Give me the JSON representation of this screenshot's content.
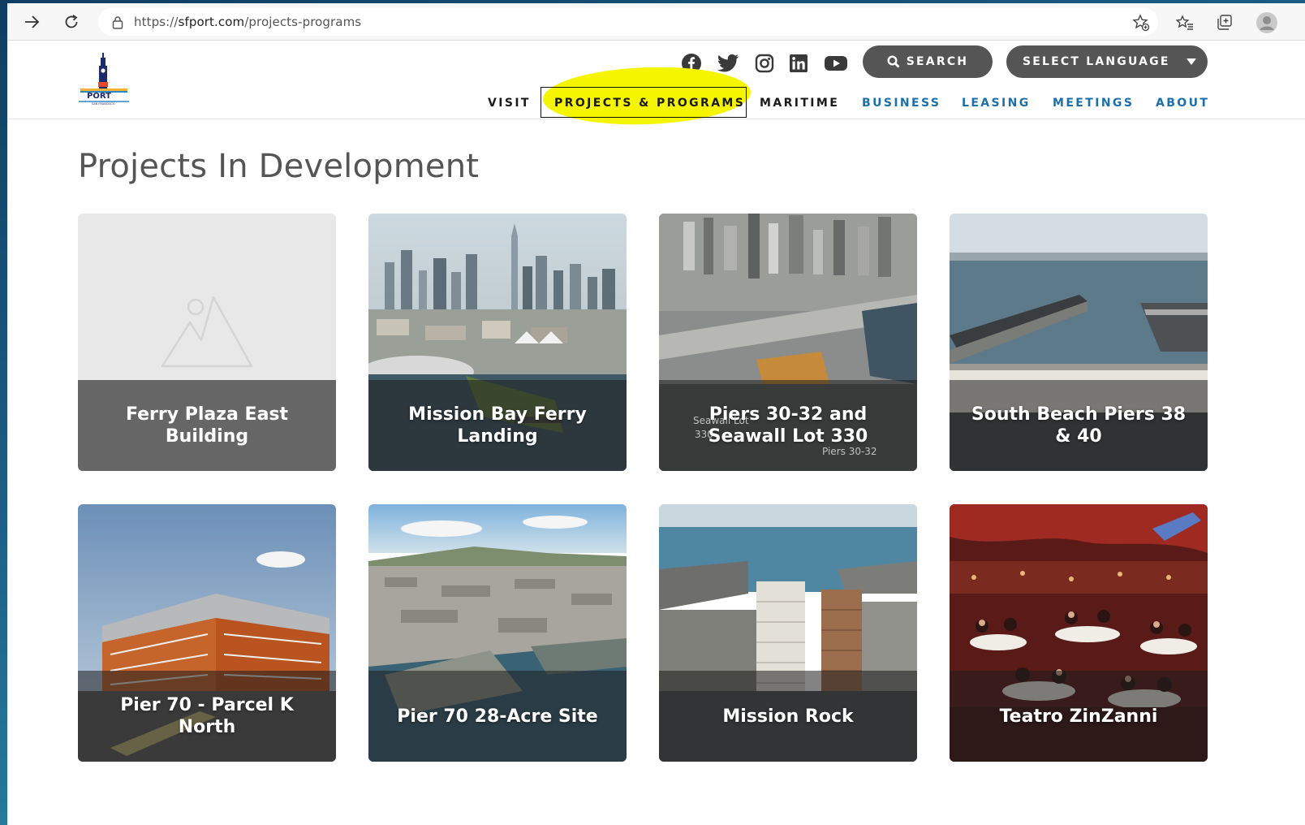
{
  "browser": {
    "url_prefix": "https://",
    "url_domain": "sfport.com",
    "url_path": "/projects-programs"
  },
  "header": {
    "search_label": "SEARCH",
    "language_label": "SELECT LANGUAGE",
    "nav": [
      "VISIT",
      "PROJECTS & PROGRAMS",
      "MARITIME",
      "BUSINESS",
      "LEASING",
      "MEETINGS",
      "ABOUT"
    ],
    "active_nav": "PROJECTS & PROGRAMS",
    "colors": {
      "nav_dark": "#1a1a1a",
      "nav_blue": "#1c6fa8",
      "button_bg": "#555555",
      "highlight": "#f6f500"
    }
  },
  "logo": {
    "text": "PORT",
    "subtext": "SAN FRANCISCO"
  },
  "social": [
    "facebook-icon",
    "twitter-icon",
    "instagram-icon",
    "linkedin-icon",
    "youtube-icon"
  ],
  "page": {
    "title": "Projects In Development",
    "cards": [
      {
        "title": "Ferry Plaza East Building"
      },
      {
        "title": "Mission Bay Ferry Landing"
      },
      {
        "title": "Piers 30-32 and Seawall Lot 330",
        "labels": [
          "Seawall Lot",
          "330",
          "Piers 30-32"
        ]
      },
      {
        "title": "South Beach Piers 38 & 40"
      },
      {
        "title": "Pier 70 - Parcel K North"
      },
      {
        "title": "Pier 70 28-Acre Site"
      },
      {
        "title": "Mission Rock"
      },
      {
        "title": "Teatro ZinZanni"
      }
    ]
  }
}
